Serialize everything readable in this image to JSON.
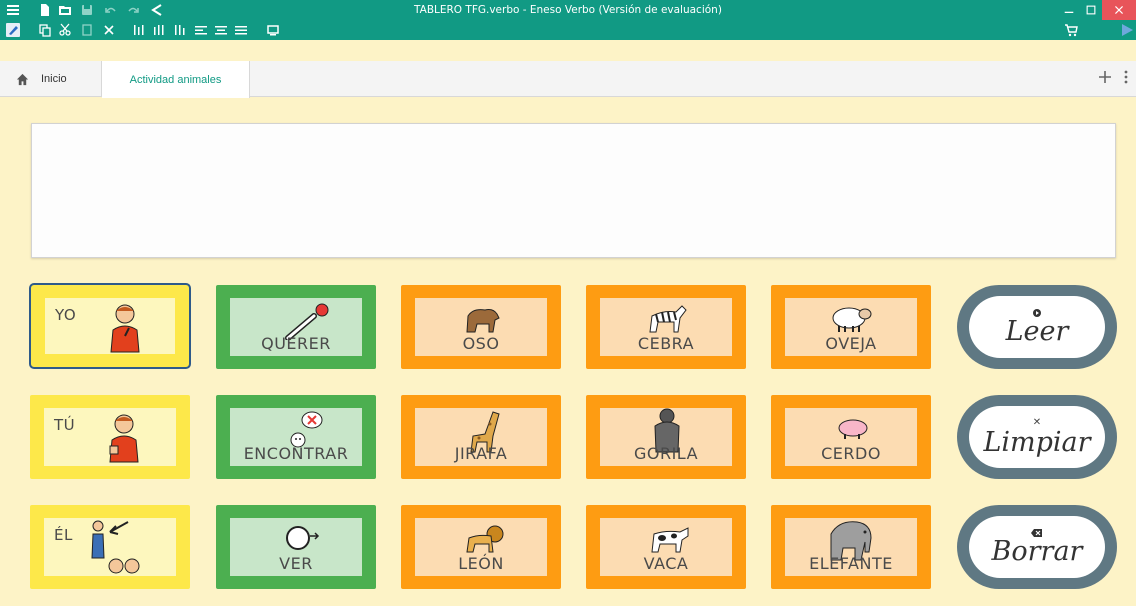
{
  "window": {
    "title": "TABLERO TFG.verbo - Eneso Verbo (Versión de evaluación)"
  },
  "toolbar": {
    "row1_icons": [
      "menu-icon",
      "new-file-icon",
      "open-folder-icon",
      "save-icon",
      "undo-icon",
      "redo-icon",
      "share-icon"
    ],
    "row2_icons": [
      "edit-mode-icon",
      "copy-icon",
      "cut-icon",
      "paste-icon",
      "delete-icon",
      "align-columns-icon",
      "distribute-columns-icon",
      "columns-icon",
      "align-left-icon",
      "align-center-icon",
      "align-justify-icon",
      "screen-icon",
      "cart-icon",
      "play-icon"
    ]
  },
  "tabs": {
    "home_label": "Inicio",
    "active_label": "Actividad animales"
  },
  "grid": {
    "rows": [
      [
        {
          "label": "YO",
          "color": "yellow",
          "pic": "boy-self"
        },
        {
          "label": "QUERER",
          "color": "green",
          "pic": "want"
        },
        {
          "label": "OSO",
          "color": "orange",
          "pic": "bear"
        },
        {
          "label": "CEBRA",
          "color": "orange",
          "pic": "zebra"
        },
        {
          "label": "OVEJA",
          "color": "orange",
          "pic": "sheep"
        }
      ],
      [
        {
          "label": "TÚ",
          "color": "yellow",
          "pic": "boy-you"
        },
        {
          "label": "ENCONTRAR",
          "color": "green",
          "pic": "find"
        },
        {
          "label": "JIRAFA",
          "color": "orange",
          "pic": "giraffe"
        },
        {
          "label": "GORILA",
          "color": "orange",
          "pic": "gorilla"
        },
        {
          "label": "CERDO",
          "color": "orange",
          "pic": "pig"
        }
      ],
      [
        {
          "label": "ÉL",
          "color": "yellow",
          "pic": "him"
        },
        {
          "label": "VER",
          "color": "green",
          "pic": "see"
        },
        {
          "label": "LEÓN",
          "color": "orange",
          "pic": "lion"
        },
        {
          "label": "VACA",
          "color": "orange",
          "pic": "cow"
        },
        {
          "label": "ELEFANTE",
          "color": "orange",
          "pic": "elephant"
        }
      ]
    ]
  },
  "actions": {
    "read_label": "Leer",
    "clear_label": "Limpiar",
    "delete_label": "Borrar"
  },
  "colors": {
    "titlebar": "#119a84",
    "background": "#fdf3c7",
    "pronoun": "#fde84a",
    "verb": "#4caf50",
    "noun": "#fe9c12",
    "action": "#5f7883"
  }
}
